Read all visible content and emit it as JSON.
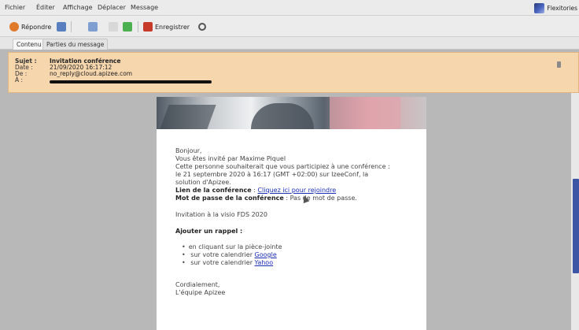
{
  "menu": [
    "Fichier",
    "Éditer",
    "Affichage",
    "Déplacer",
    "Message"
  ],
  "brand": "Flexitories",
  "toolbar": {
    "reply_label": "Répondre",
    "save_label": "Enregistrer"
  },
  "tabs": [
    "Contenu",
    "Parties du message"
  ],
  "header": {
    "subject_label": "Sujet :",
    "subject": "Invitation conférence",
    "date_label": "Date :",
    "date": "21/09/2020 16:17:12",
    "from_label": "De :",
    "from": "no_reply@cloud.apizee.com",
    "to_label": "À :"
  },
  "body": {
    "greeting": "Bonjour,",
    "invited": "Vous êtes invité par Maxime Piquel",
    "desc1": "Cette personne souhaiterait que vous participiez à une conférence :",
    "desc2": "le 21 septembre 2020 à 16:17 (GMT +02:00) sur IzeeConf, la",
    "desc3": "solution d'Apizee.",
    "link_label": "Lien de la conférence",
    "link_sep": " : ",
    "link_text": "Cliquez ici pour rejoindre",
    "pwd_label": "Mot de passe de la conférence",
    "pwd_value": " : Pas de mot de passe.",
    "topic": "Invitation à la visio FDS 2020",
    "reminder_title": "Ajouter un rappel :",
    "r1": "en cliquant sur la pièce-jointe",
    "r2_prefix": "sur votre calendrier ",
    "r2_link": "Google",
    "r3_prefix": "sur votre calendrier ",
    "r3_link": "Yahoo",
    "closing": "Cordialement,",
    "signature": "L'équipe Apizee"
  },
  "colors": {
    "header_bg": "#f6d6ad",
    "link": "#1a2fb5",
    "scroll_thumb": "#3c55a5"
  }
}
